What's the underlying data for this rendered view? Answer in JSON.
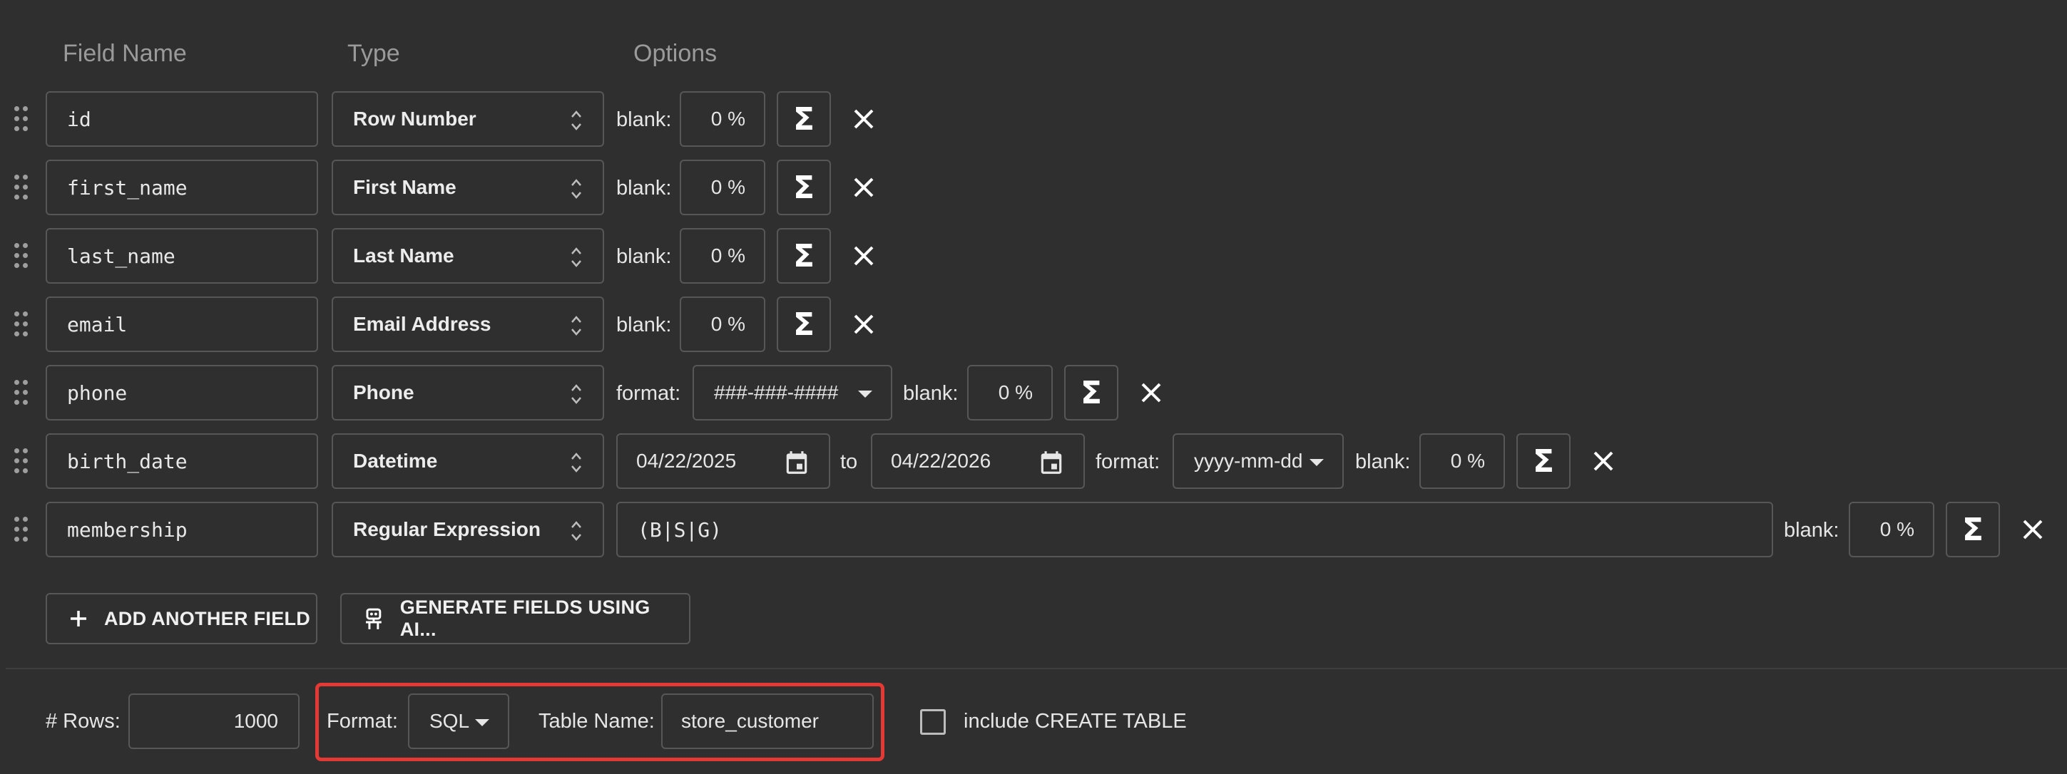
{
  "headers": {
    "field_name": "Field Name",
    "type": "Type",
    "options": "Options"
  },
  "fields": [
    {
      "name": "id",
      "type": "Row Number",
      "blank_label": "blank:",
      "blank": "0 %"
    },
    {
      "name": "first_name",
      "type": "First Name",
      "blank_label": "blank:",
      "blank": "0 %"
    },
    {
      "name": "last_name",
      "type": "Last Name",
      "blank_label": "blank:",
      "blank": "0 %"
    },
    {
      "name": "email",
      "type": "Email Address",
      "blank_label": "blank:",
      "blank": "0 %"
    },
    {
      "name": "phone",
      "type": "Phone",
      "format_label": "format:",
      "format": "###-###-####",
      "blank_label": "blank:",
      "blank": "0 %"
    },
    {
      "name": "birth_date",
      "type": "Datetime",
      "from": "04/22/2025",
      "to_label": "to",
      "to": "04/22/2026",
      "format_label": "format:",
      "format": "yyyy-mm-dd",
      "blank_label": "blank:",
      "blank": "0 %"
    },
    {
      "name": "membership",
      "type": "Regular Expression",
      "regex": "(B|S|G)",
      "blank_label": "blank:",
      "blank": "0 %"
    }
  ],
  "actions": {
    "add_field": "ADD ANOTHER FIELD",
    "generate_ai": "GENERATE FIELDS USING AI..."
  },
  "footer": {
    "rows_label": "# Rows:",
    "rows": "1000",
    "format_label": "Format:",
    "format": "SQL",
    "table_label": "Table Name:",
    "table_name": "store_customer",
    "create_table_label": "include CREATE TABLE"
  },
  "colors": {
    "background": "#2f2f2f",
    "border": "#575757",
    "highlight": "#e53935"
  }
}
